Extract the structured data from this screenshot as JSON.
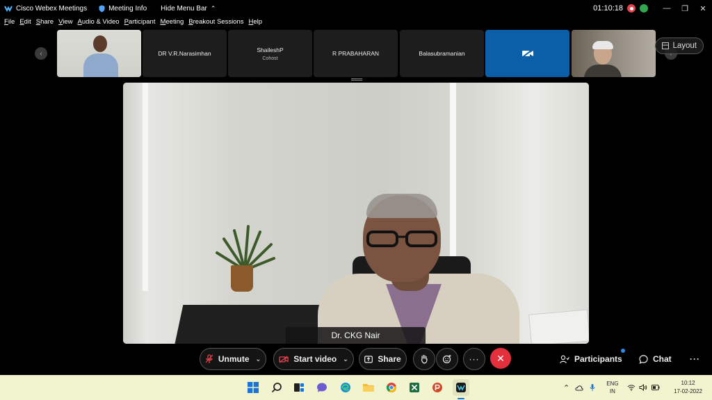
{
  "window": {
    "app_title": "Cisco Webex Meetings",
    "meeting_info": "Meeting Info",
    "hide_menu_bar": "Hide Menu Bar",
    "timer": "01:10:18"
  },
  "menu": [
    {
      "first": "F",
      "rest": "ile"
    },
    {
      "first": "E",
      "rest": "dit"
    },
    {
      "first": "S",
      "rest": "hare"
    },
    {
      "first": "V",
      "rest": "iew"
    },
    {
      "first": "A",
      "rest": "udio & Video"
    },
    {
      "first": "P",
      "rest": "articipant"
    },
    {
      "first": "M",
      "rest": "eeting"
    },
    {
      "first": "B",
      "rest": "reakout Sessions"
    },
    {
      "first": "H",
      "rest": "elp"
    }
  ],
  "thumbnails": [
    {
      "name": "",
      "type": "video"
    },
    {
      "name": "DR V.R.Narasimhan",
      "type": "name"
    },
    {
      "name": "ShaileshP",
      "sub": "Cohost",
      "type": "name"
    },
    {
      "name": "R PRABAHARAN",
      "type": "name"
    },
    {
      "name": "Balasubramanian",
      "type": "name"
    },
    {
      "name": "",
      "type": "camera-off"
    },
    {
      "name": "",
      "type": "video"
    }
  ],
  "layout_button": "Layout",
  "active_speaker": "Dr. CKG Nair",
  "controls": {
    "unmute": "Unmute",
    "start_video": "Start video",
    "share": "Share",
    "participants": "Participants",
    "chat": "Chat"
  },
  "taskbar": {
    "lang_top": "ENG",
    "lang_bottom": "IN",
    "time": "10:12",
    "date": "17-02-2022"
  },
  "colors": {
    "end_call": "#e4303c",
    "record": "#e4434b",
    "network": "#2fa84f",
    "camera_off_tile": "#0b5fa8",
    "taskbar": "#f1f4cf"
  }
}
